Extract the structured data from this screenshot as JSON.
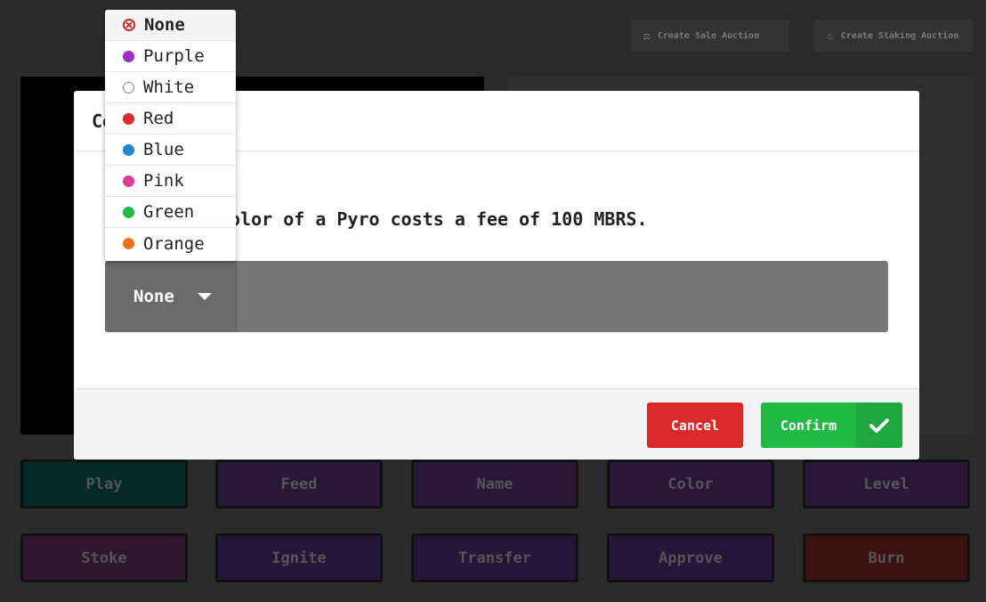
{
  "toolbar": {
    "sale_auction_label": "Create Sale Auction",
    "staking_auction_label": "Create Staking Auction"
  },
  "actions": {
    "row1": [
      "Play",
      "Feed",
      "Name",
      "Color",
      "Level"
    ],
    "row2": [
      "Stoke",
      "Ignite",
      "Transfer",
      "Approve",
      "Burn"
    ]
  },
  "modal": {
    "title": "Co",
    "description": "olor of a Pyro costs a fee of 100 MBRS.",
    "select_value": "None",
    "cancel_label": "Cancel",
    "confirm_label": "Confirm"
  },
  "dropdown": {
    "options": [
      {
        "label": "None",
        "color": "#c62828"
      },
      {
        "label": "Purple",
        "color": "#9c2fc4"
      },
      {
        "label": "White",
        "color": "#ffffff"
      },
      {
        "label": "Red",
        "color": "#db2828"
      },
      {
        "label": "Blue",
        "color": "#2185d0"
      },
      {
        "label": "Pink",
        "color": "#e03997"
      },
      {
        "label": "Green",
        "color": "#21ba45"
      },
      {
        "label": "Orange",
        "color": "#f2711c"
      }
    ]
  }
}
